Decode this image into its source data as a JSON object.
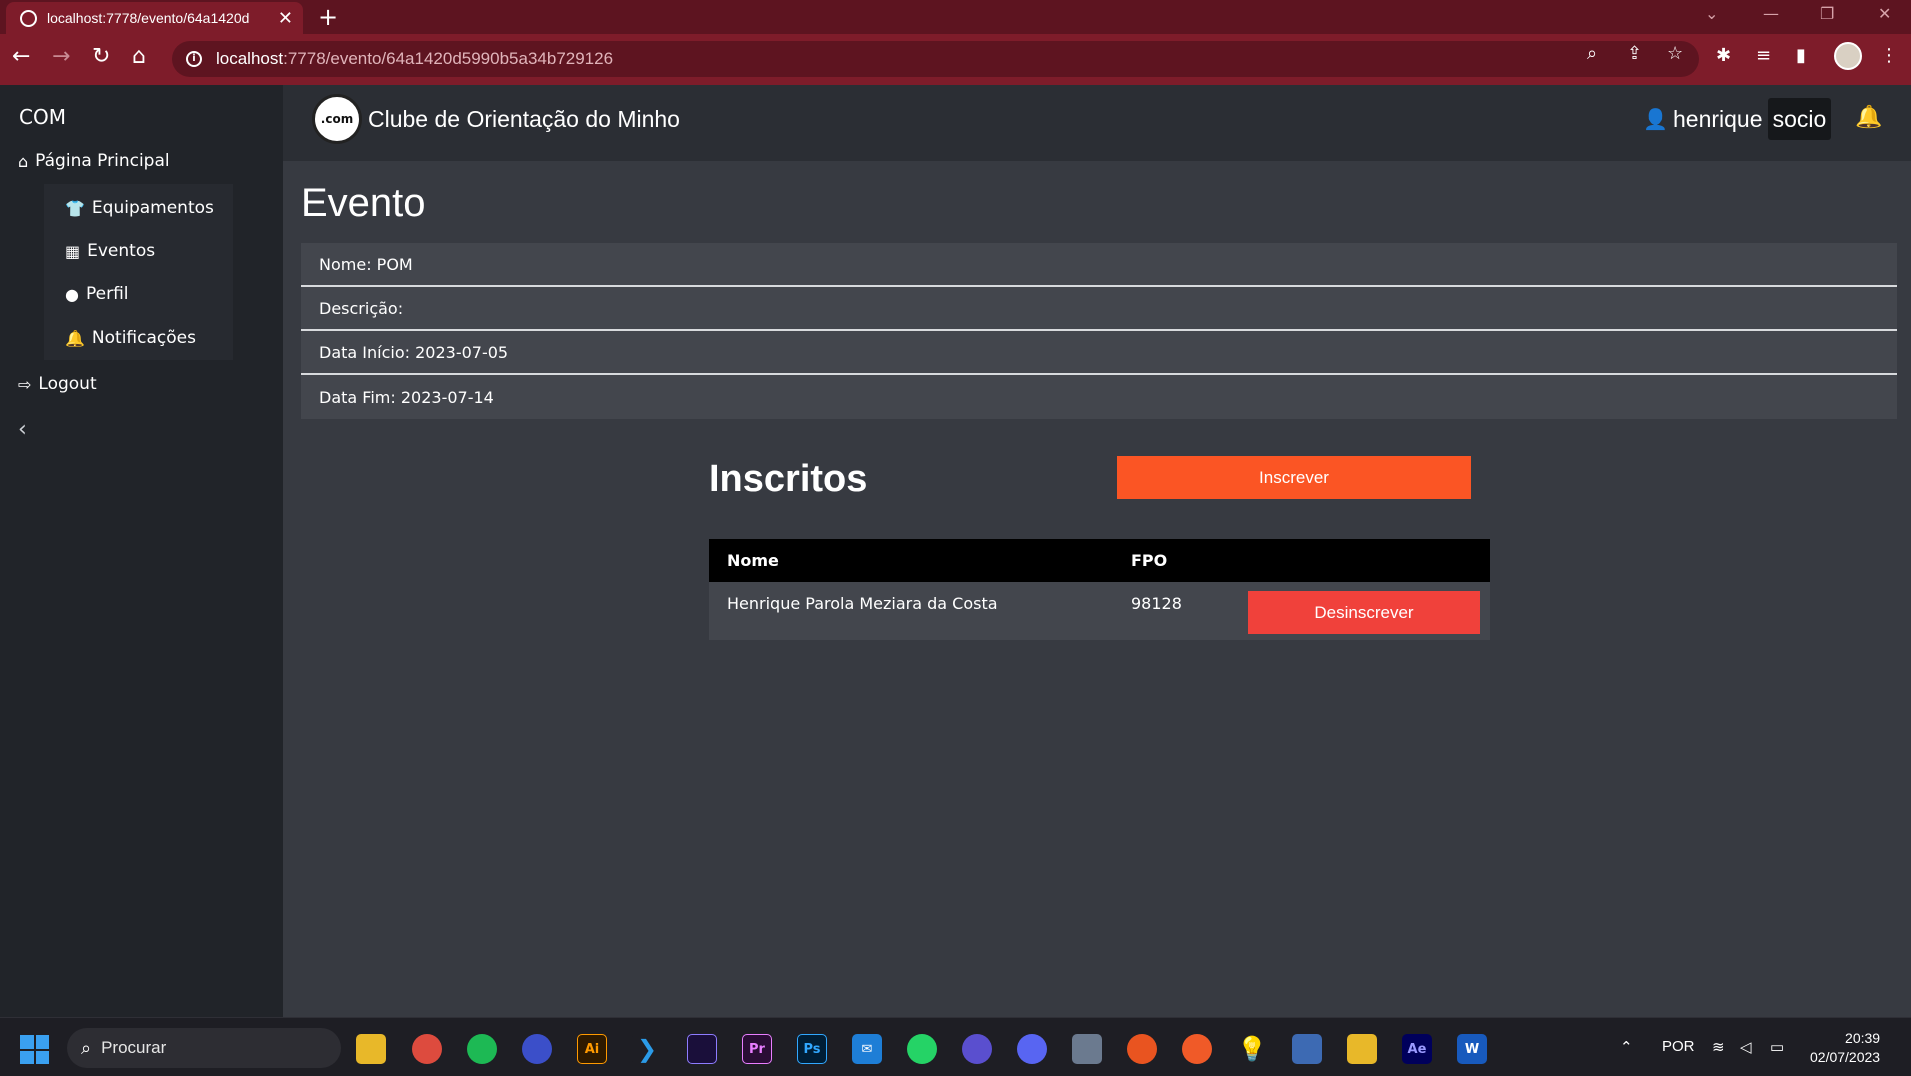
{
  "browser": {
    "tab_title": "localhost:7778/evento/64a1420d",
    "url_host": "localhost",
    "url_rest": ":7778/evento/64a1420d5990b5a34b729126"
  },
  "sidebar": {
    "brand": "COM",
    "home": "Página Principal",
    "items": [
      {
        "label": "Equipamentos",
        "icon": "shirt-icon"
      },
      {
        "label": "Eventos",
        "icon": "calendar-icon"
      },
      {
        "label": "Perfil",
        "icon": "user-icon"
      },
      {
        "label": "Notificações",
        "icon": "bell-icon"
      }
    ],
    "logout": "Logout"
  },
  "header": {
    "logo_text": ".com",
    "title": "Clube de Orientação do Minho",
    "user": "henrique",
    "role": "socio"
  },
  "event": {
    "page_title": "Evento",
    "fields": [
      {
        "label": "Nome:",
        "value": "POM"
      },
      {
        "label": "Descrição:",
        "value": ""
      },
      {
        "label": "Data Início:",
        "value": "2023-07-05"
      },
      {
        "label": "Data Fim:",
        "value": "2023-07-14"
      }
    ]
  },
  "inscritos": {
    "title": "Inscritos",
    "subscribe_label": "Inscrever",
    "columns": [
      "Nome",
      "FPO"
    ],
    "rows": [
      {
        "name": "Henrique Parola Meziara da Costa",
        "fpo": "98128",
        "action": "Desinscrever"
      }
    ]
  },
  "taskbar": {
    "search_placeholder": "Procurar",
    "language": "POR",
    "time": "20:39",
    "date": "02/07/2023"
  },
  "colors": {
    "browser_accent": "#7e1c2a",
    "subscribe": "#fb5524",
    "unsubscribe": "#f0413b",
    "sidebar": "#212429",
    "content": "#373a41"
  }
}
